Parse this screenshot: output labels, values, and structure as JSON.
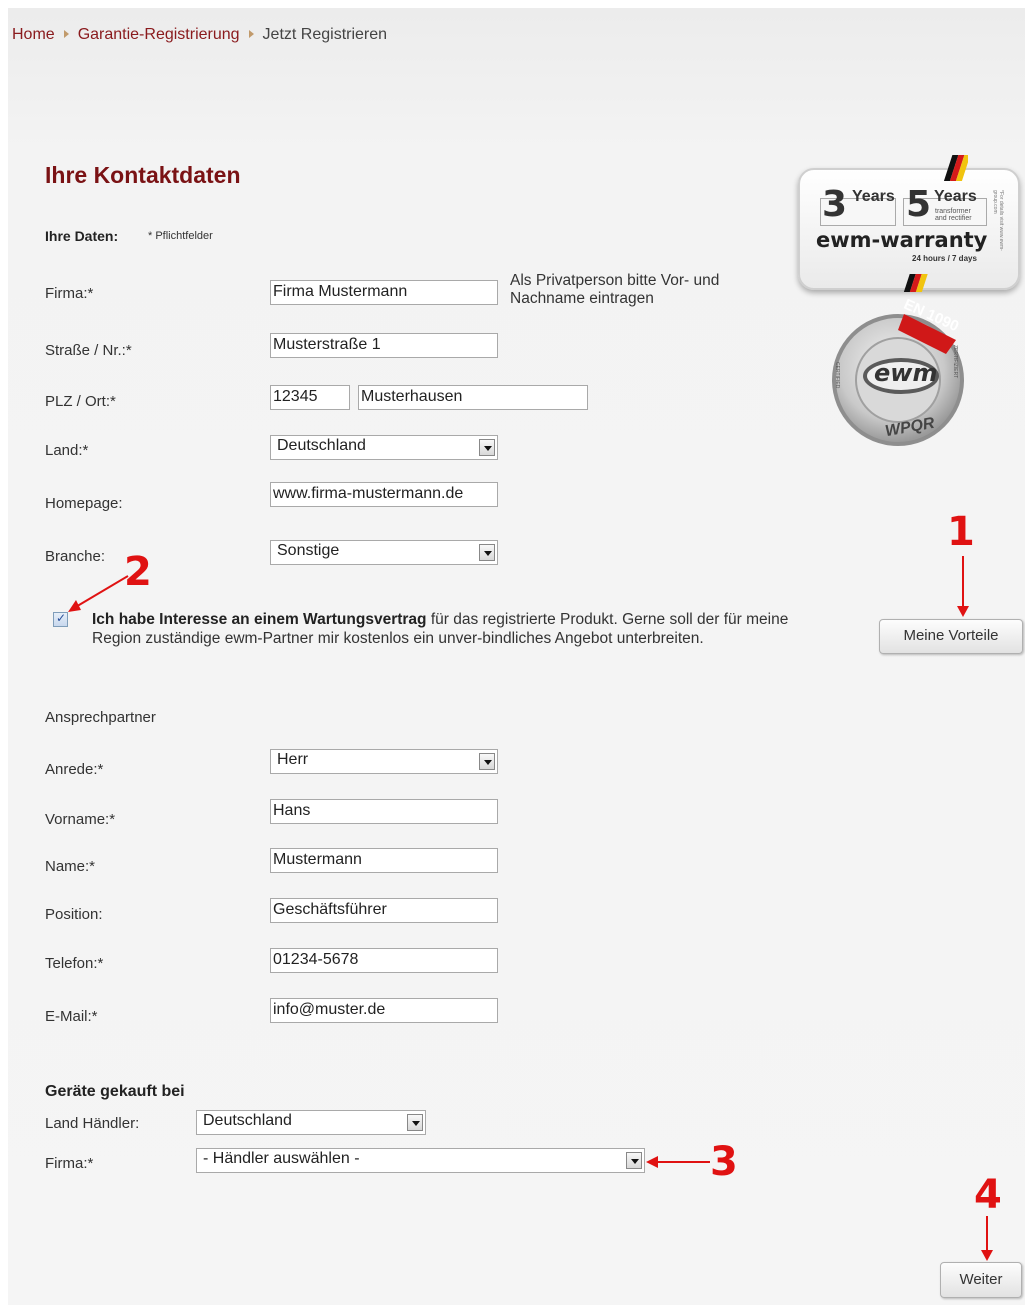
{
  "breadcrumb": {
    "home": "Home",
    "warranty": "Garantie-Registrierung",
    "current": "Jetzt Registrieren"
  },
  "page_title": "Ihre Kontaktdaten",
  "your_data": {
    "heading": "Ihre Daten:",
    "required_note": "* Pflichtfelder"
  },
  "company_form": {
    "firma_label": "Firma:*",
    "firma_value": "Firma Mustermann",
    "firma_hint": "Als Privatperson bitte Vor- und Nachname eintragen",
    "street_label": "Straße / Nr.:*",
    "street_value": "Musterstraße 1",
    "zip_city_label": "PLZ / Ort:*",
    "zip_value": "12345",
    "city_value": "Musterhausen",
    "country_label": "Land:*",
    "country_value": "Deutschland",
    "homepage_label": "Homepage:",
    "homepage_value": "www.firma-mustermann.de",
    "industry_label": "Branche:",
    "industry_value": "Sonstige"
  },
  "maintenance": {
    "checked": true,
    "bold_text": "Ich habe Interesse an einem Wartungsvertrag",
    "text_rest": " für das registrierte Produkt. Gerne soll der für meine Region zuständige ewm-Partner mir kostenlos ein unver-bindliches Angebot unterbreiten."
  },
  "contact_person": {
    "heading": "Ansprechpartner",
    "salutation_label": "Anrede:*",
    "salutation_value": "Herr",
    "firstname_label": "Vorname:*",
    "firstname_value": "Hans",
    "name_label": "Name:*",
    "name_value": "Mustermann",
    "position_label": "Position:",
    "position_value": "Geschäftsführer",
    "phone_label": "Telefon:*",
    "phone_value": "01234-5678",
    "email_label": "E-Mail:*",
    "email_value": "info@muster.de"
  },
  "purchased": {
    "heading": "Geräte gekauft bei",
    "dealer_country_label": "Land Händler:",
    "dealer_country_value": "Deutschland",
    "dealer_label": "Firma:*",
    "dealer_value": "- Händler auswählen -"
  },
  "buttons": {
    "benefits": "Meine Vorteile",
    "next": "Weiter"
  },
  "annotations": [
    "1",
    "2",
    "3",
    "4"
  ],
  "badges": {
    "warranty_years_1": "3",
    "warranty_years_2": "5",
    "years_word": "Years",
    "transformer_note": "transformer and rectifier",
    "brand": "ewm-warranty",
    "hours": "24 hours / 7 days",
    "side_note": "*For details visit www.ewm-group.com",
    "seal_top": "EN 1090",
    "seal_logo": "ewm",
    "seal_bottom": "WPQR",
    "seal_left": "CERTIFIED",
    "seal_right": "ZERTIFIZIERT"
  },
  "colors": {
    "title": "#7a1214",
    "link": "#8a1a1d",
    "annotation": "#e01212"
  }
}
